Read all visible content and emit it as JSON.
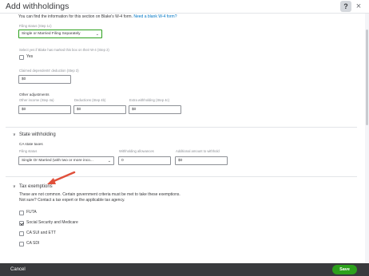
{
  "header": {
    "title": "Add withholdings",
    "help_icon": "?",
    "close_icon": "×"
  },
  "federal": {
    "intro_text": "You can find the information for this section on Blake's W-4 form.",
    "intro_link": "Need a blank W-4 form?",
    "filing_status_label": "Filing status (Step 1c)",
    "filing_status_value": "Single or Married Filing Separately",
    "step2_label": "Select yes if Blake has marked this box on their W-4 (Step 2)",
    "step2_option": "Yes",
    "dependents_label": "Claimed dependents' deduction (Step 3)",
    "dependents_value": "$0",
    "other_adjustments": "Other adjustments",
    "other_income_label": "Other income (Step 4a)",
    "other_income_value": "$0",
    "deductions_label": "Deductions (Step 4b)",
    "deductions_value": "$0",
    "extra_withholding_label": "Extra withholding (Step 4c)",
    "extra_withholding_value": "$0"
  },
  "state": {
    "title": "State withholding",
    "subtitle": "CA state taxes",
    "filing_status_label": "Filing status",
    "filing_status_value": "Single Or Married (with two or more inco...",
    "allowances_label": "Withholding allowances",
    "allowances_value": "0",
    "additional_label": "Additional amount to withhold",
    "additional_value": "$0"
  },
  "tax_exemptions": {
    "title": "Tax exemptions",
    "desc_line1": "These are not common. Certain government criteria must be met to take these exemptions.",
    "desc_line2": "Not sure? Contact a tax expert or the applicable tax agency.",
    "options": [
      {
        "label": "FUTA",
        "checked": false
      },
      {
        "label": "Social Security and Medicare",
        "checked": true
      },
      {
        "label": "CA SUI and ETT",
        "checked": false
      },
      {
        "label": "CA SDI",
        "checked": false
      }
    ]
  },
  "footer": {
    "cancel_label": "Cancel",
    "save_label": "Save"
  },
  "colors": {
    "accent_green": "#2ca01c",
    "link_blue": "#0077c5",
    "footer_dark": "#393a3d",
    "annotation_red": "#e0503b"
  }
}
